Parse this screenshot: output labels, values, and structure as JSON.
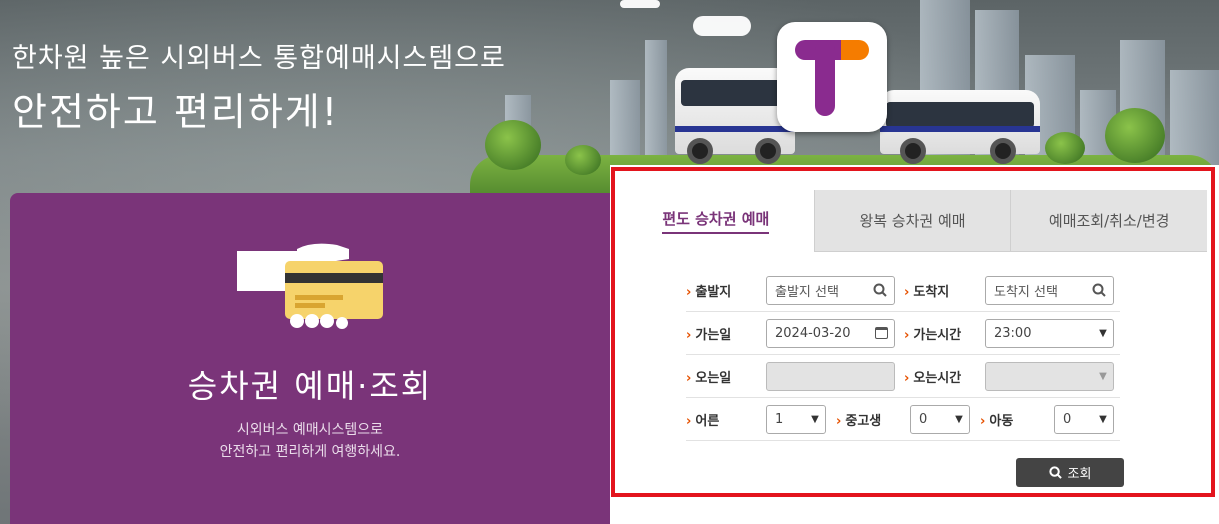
{
  "hero": {
    "line1": "한차원 높은 시외버스 통합예매시스템으로",
    "line2": "안전하고 편리하게!"
  },
  "logo": {
    "icon": "tmoney-t-logo",
    "colors": {
      "purple": "#8a2b8f",
      "orange": "#f57c00"
    }
  },
  "card": {
    "icon": "card-in-hand-icon",
    "title": "승차권 예매·조회",
    "desc_line1": "시외버스 예매시스템으로",
    "desc_line2": "안전하고 편리하게 여행하세요."
  },
  "tabs": [
    {
      "label": "편도 승차권 예매",
      "active": true
    },
    {
      "label": "왕복 승차권 예매",
      "active": false
    },
    {
      "label": "예매조회/취소/변경",
      "active": false
    }
  ],
  "form": {
    "departure": {
      "label": "출발지",
      "placeholder": "출발지 선택"
    },
    "arrival": {
      "label": "도착지",
      "placeholder": "도착지 선택"
    },
    "go_date": {
      "label": "가는일",
      "value": "2024-03-20"
    },
    "go_time": {
      "label": "가는시간",
      "value": "23:00"
    },
    "return_date": {
      "label": "오는일",
      "value": ""
    },
    "return_time": {
      "label": "오는시간",
      "value": ""
    },
    "adult": {
      "label": "어른",
      "value": "1"
    },
    "student": {
      "label": "중고생",
      "value": "0"
    },
    "child": {
      "label": "아동",
      "value": "0"
    },
    "search_button": "조회"
  },
  "colors": {
    "accent": "#7a3479",
    "highlight": "#e3141d",
    "label_chevron": "#e65100"
  }
}
